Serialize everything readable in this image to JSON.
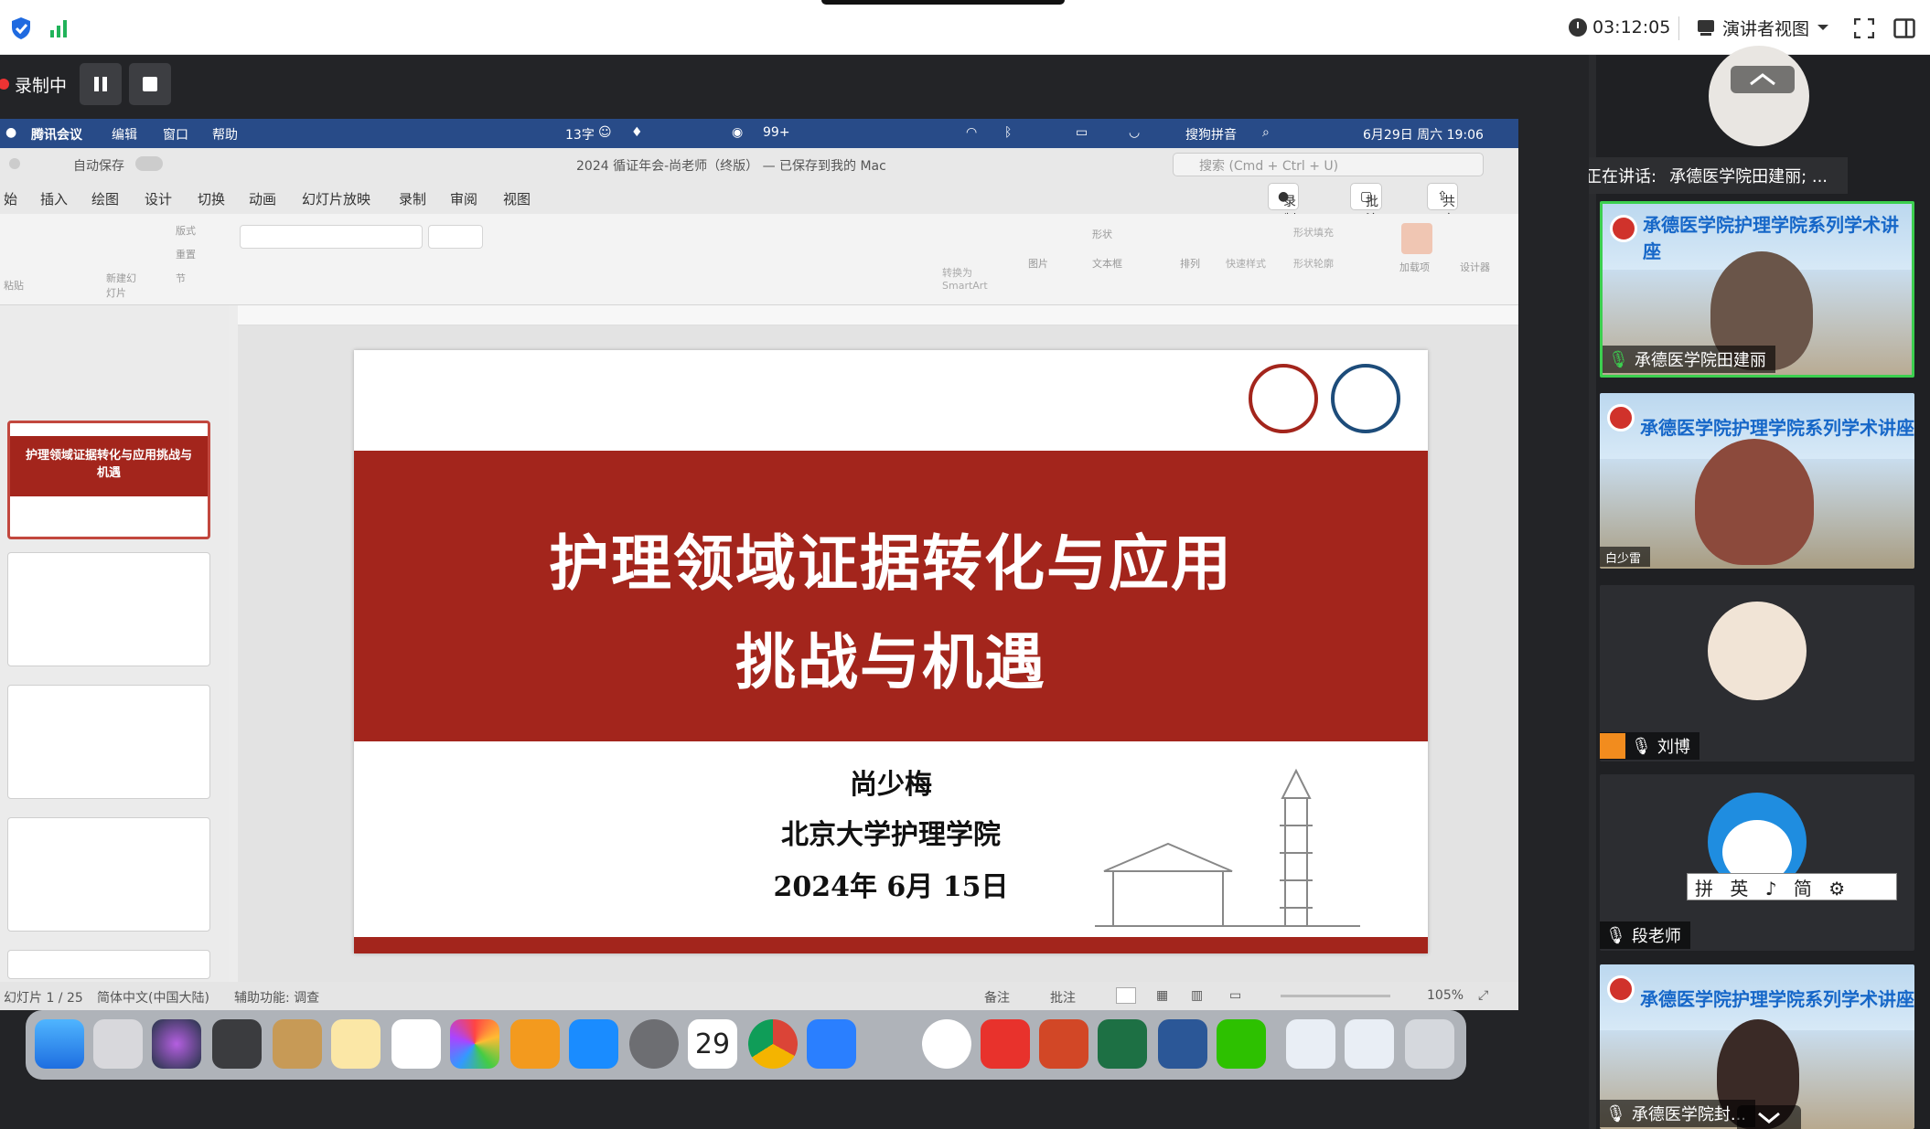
{
  "topbar": {
    "timer": "03:12:05",
    "view_mode": "演讲者视图"
  },
  "recording": {
    "label": "录制中"
  },
  "mac_menu": {
    "app": "腾讯会议",
    "items": [
      "编辑",
      "窗口",
      "帮助"
    ],
    "status_left": "13字",
    "badge": "99+",
    "ime": "搜狗拼音",
    "datetime": "6月29日 周六 19:06"
  },
  "ppt": {
    "doc_title": "2024 循证年会-尚老师（终版） — 已保存到我的 Mac",
    "autosave": "自动保存",
    "search_placeholder": "搜索 (Cmd + Ctrl + U)",
    "tabs": [
      "始",
      "插入",
      "绘图",
      "设计",
      "切换",
      "动画",
      "幻灯片放映",
      "录制",
      "审阅",
      "视图"
    ],
    "record_btn": "录制",
    "comment_btn": "批注",
    "share_btn": "共享",
    "ribbon_labels": [
      "粘贴",
      "新建幻灯片",
      "版式",
      "重置",
      "节",
      "转换为SmartArt",
      "图片",
      "形状",
      "文本框",
      "排列",
      "快速样式",
      "形状填充",
      "形状轮廓",
      "加载项",
      "设计器"
    ]
  },
  "slide": {
    "title_line1": "护理领域证据转化与应用",
    "title_line2": "挑战与机遇",
    "author": "尚少梅",
    "affiliation": "北京大学护理学院",
    "date": "2024年 6月 15日"
  },
  "thumb1": {
    "title": "护理领域证据转化与应用挑战与机遇"
  },
  "statusbar": {
    "slide_no": "幻灯片 1 / 25",
    "lang": "简体中文(中国大陆)",
    "a11y": "辅助功能: 调查",
    "notes": "备注",
    "comments": "批注",
    "zoom": "105%"
  },
  "dock": {
    "calendar_day": "29"
  },
  "speaking": {
    "label": "正在讲话:",
    "names": "承德医学院田建丽; ..."
  },
  "participants": [
    {
      "name": "承德医学院田建丽",
      "banner": "承德医学院护理学院系列学术讲座"
    },
    {
      "name": "白少雷",
      "banner": "承德医学院护理学院系列学术讲座"
    },
    {
      "name": "刘博"
    },
    {
      "name": "段老师",
      "ime_text": "拼 英 ♪ 简 ⚙"
    },
    {
      "name": "承德医学院封...",
      "banner": "承德医学院护理学院系列学术讲座"
    }
  ],
  "colors": {
    "accent_red": "#a3251c",
    "mac_menubar": "#284b88",
    "speaking_green": "#3ccf4f",
    "banner_blue": "#1667c8"
  }
}
